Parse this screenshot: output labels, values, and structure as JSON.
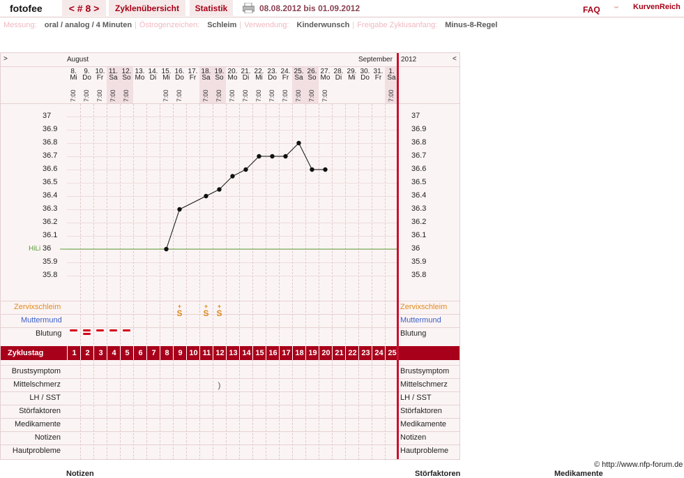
{
  "topbar": {
    "username": "fotofee",
    "cycle_nav": "< # 8 >",
    "overview": "Zyklenübersicht",
    "stats": "Statistik",
    "date_range": "08.08.2012 bis 01.09.2012",
    "faq": "FAQ",
    "logo_text": "KurvenReich"
  },
  "settings": {
    "measure_label": "Messung:",
    "measure_value": "oral / analog / 4 Minuten",
    "estrogen_label": "Östrogenzeichen:",
    "estrogen_value": "Schleim",
    "use_label": "Verwendung:",
    "use_value": "Kinderwunsch",
    "release_label": "Freigabe Zyklusanfang:",
    "release_value": "Minus-8-Regel"
  },
  "chart": {
    "left_arrow": ">",
    "right_arrow": "<",
    "month_start": "August",
    "month_end": "September",
    "year": "2012",
    "hili_label": "HiLi",
    "cervix_label": "Zervixschleim",
    "cervix_label_right": "Zervixschleim",
    "mumu_label": "Muttermund",
    "mumu_label_right": "Muttermund",
    "bleeding_label": "Blutung",
    "bleeding_label_right": "Blutung",
    "cycle_day_label": "Zyklustag",
    "rows": [
      "Brustsymptom",
      "Mittelschmerz",
      "LH / SST",
      "Störfaktoren",
      "Medikamente",
      "Notizen",
      "Hautprobleme"
    ],
    "rows_right": [
      "Brustsymptom",
      "Mittelschmerz",
      "LH / SST",
      "Störfaktoren",
      "Medikamente",
      "Notizen",
      "Hautprobleme"
    ],
    "copyright": "© http://www.nfp-forum.de",
    "footer": [
      "Notizen",
      "Störfaktoren",
      "Medikamente"
    ]
  },
  "days": [
    {
      "date": "8.",
      "wd": "Mi",
      "time": "7:00"
    },
    {
      "date": "9.",
      "wd": "Do",
      "time": "7:00"
    },
    {
      "date": "10.",
      "wd": "Fr",
      "time": "7:00"
    },
    {
      "date": "11.",
      "wd": "Sa",
      "time": "7:00"
    },
    {
      "date": "12.",
      "wd": "So",
      "time": "7:00"
    },
    {
      "date": "13.",
      "wd": "Mo",
      "time": ""
    },
    {
      "date": "14.",
      "wd": "Di",
      "time": ""
    },
    {
      "date": "15.",
      "wd": "Mi",
      "time": "7:00"
    },
    {
      "date": "16.",
      "wd": "Do",
      "time": "7:00"
    },
    {
      "date": "17.",
      "wd": "Fr",
      "time": ""
    },
    {
      "date": "18.",
      "wd": "Sa",
      "time": "7:00"
    },
    {
      "date": "19.",
      "wd": "So",
      "time": "7:00"
    },
    {
      "date": "20.",
      "wd": "Mo",
      "time": "7:00"
    },
    {
      "date": "21.",
      "wd": "Di",
      "time": "7:00"
    },
    {
      "date": "22.",
      "wd": "Mi",
      "time": "7:00"
    },
    {
      "date": "23.",
      "wd": "Do",
      "time": "7:00"
    },
    {
      "date": "24.",
      "wd": "Fr",
      "time": "7:00"
    },
    {
      "date": "25.",
      "wd": "Sa",
      "time": "7:00"
    },
    {
      "date": "26.",
      "wd": "So",
      "time": "7:00"
    },
    {
      "date": "27.",
      "wd": "Mo",
      "time": "7:00"
    },
    {
      "date": "28.",
      "wd": "Di",
      "time": ""
    },
    {
      "date": "29.",
      "wd": "Mi",
      "time": ""
    },
    {
      "date": "30.",
      "wd": "Do",
      "time": ""
    },
    {
      "date": "31.",
      "wd": "Fr",
      "time": ""
    },
    {
      "date": "1.",
      "wd": "Sa",
      "time": "7:00"
    }
  ],
  "y_ticks": [
    "37",
    "36.9",
    "36.8",
    "36.7",
    "36.6",
    "36.5",
    "36.4",
    "36.3",
    "36.2",
    "36.1",
    "36",
    "35.9",
    "35.8"
  ],
  "temperatures": [
    null,
    null,
    null,
    null,
    null,
    null,
    null,
    36.0,
    36.3,
    null,
    36.4,
    36.45,
    36.55,
    36.6,
    36.7,
    36.7,
    36.7,
    36.8,
    36.6,
    36.6,
    null,
    null,
    null,
    null,
    null
  ],
  "cervix_symbol": "S",
  "cervix_days": [
    9,
    11,
    12
  ],
  "bleeding": [
    1,
    2,
    1,
    1,
    1,
    0,
    0,
    0,
    0,
    0,
    0,
    0,
    0,
    0,
    0,
    0,
    0,
    0,
    0,
    0,
    0,
    0,
    0,
    0,
    0
  ],
  "mittelschmerz_symbol": ")",
  "mittelschmerz_day": 12,
  "colors": {
    "accent": "#a8001a",
    "cervix": "#e08a1e",
    "mumu": "#3b5fc8",
    "hili": "#5a9e3a",
    "bleeding": "#d4001a"
  }
}
